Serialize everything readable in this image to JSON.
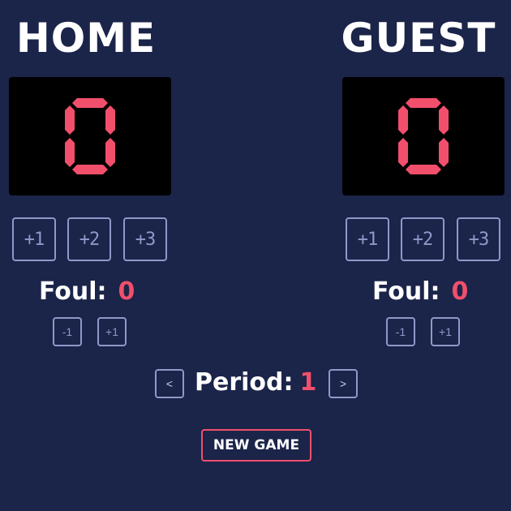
{
  "colors": {
    "background": "#1b2449",
    "score_digit": "#f14f6c",
    "button_outline": "#8f99c9",
    "accent": "#f14f6c",
    "text": "#ffffff",
    "score_bg": "#000000"
  },
  "home": {
    "title": "HOME",
    "score": "0",
    "buttons": [
      "+1",
      "+2",
      "+3"
    ],
    "foul_label": "Foul:",
    "foul_value": "0",
    "foul_minus": "-1",
    "foul_plus": "+1"
  },
  "guest": {
    "title": "GUEST",
    "score": "0",
    "buttons": [
      "+1",
      "+2",
      "+3"
    ],
    "foul_label": "Foul:",
    "foul_value": "0",
    "foul_minus": "-1",
    "foul_plus": "+1"
  },
  "period": {
    "prev_label": "<",
    "label": "Period:",
    "value": "1",
    "next_label": ">"
  },
  "new_game_label": "NEW GAME"
}
